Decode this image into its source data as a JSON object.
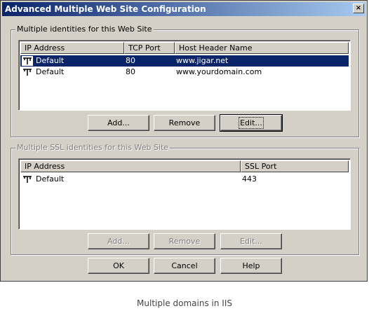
{
  "window": {
    "title": "Advanced Multiple Web Site Configuration",
    "close_label": "×"
  },
  "identities": {
    "group_label": "Multiple identities for this Web Site",
    "columns": [
      "IP Address",
      "TCP Port",
      "Host Header Name"
    ],
    "rows": [
      {
        "ip": "Default",
        "port": "80",
        "host": "www.jigar.net",
        "selected": true
      },
      {
        "ip": "Default",
        "port": "80",
        "host": "www.yourdomain.com",
        "selected": false
      }
    ],
    "buttons": {
      "add": "Add...",
      "remove": "Remove",
      "edit": "Edit..."
    }
  },
  "ssl": {
    "group_label": "Multiple SSL identities for this Web Site",
    "columns": [
      "IP Address",
      "SSL Port"
    ],
    "rows": [
      {
        "ip": "Default",
        "port": "443"
      }
    ],
    "buttons": {
      "add": "Add...",
      "remove": "Remove",
      "edit": "Edit..."
    }
  },
  "footer": {
    "ok": "OK",
    "cancel": "Cancel",
    "help": "Help"
  },
  "caption": "Multiple domains in IIS",
  "colors": {
    "titlebar_start": "#0a246a",
    "titlebar_end": "#a6caf0",
    "face": "#d4d0c8",
    "selection": "#0a246a"
  }
}
